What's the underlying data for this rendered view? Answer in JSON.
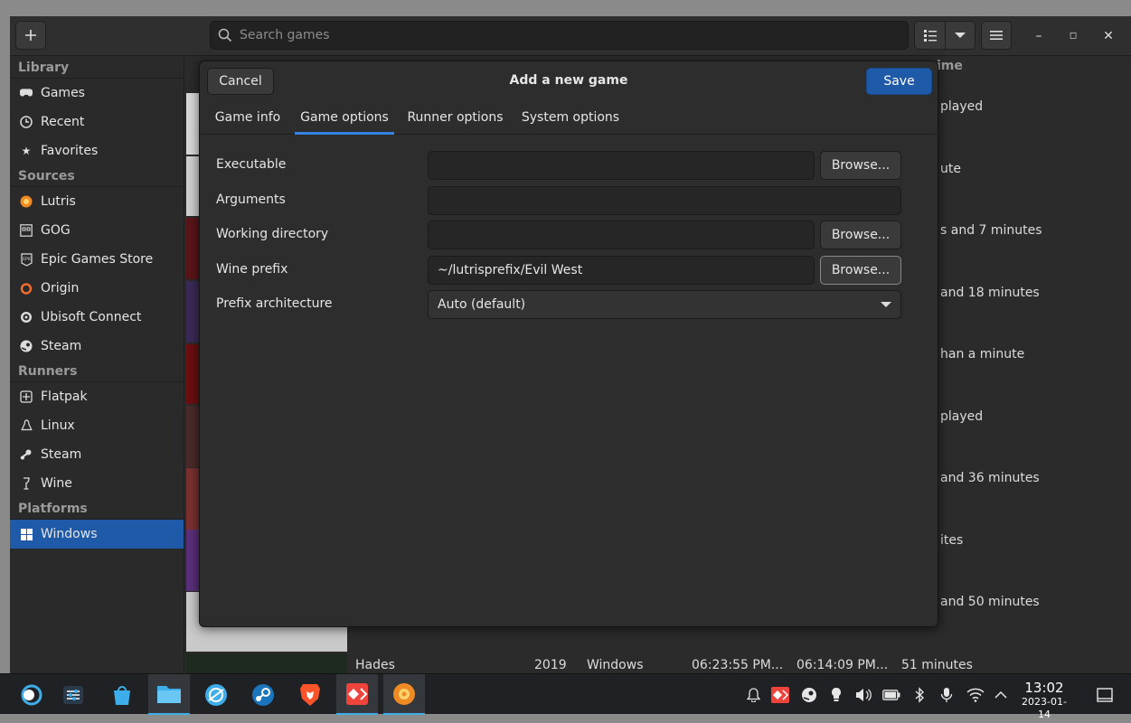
{
  "header": {
    "add_icon": "plus-icon",
    "search_placeholder": "Search games"
  },
  "sidebar": {
    "sections": [
      {
        "title": "Library",
        "items": [
          {
            "label": "Games",
            "icon": "gamepad-icon"
          },
          {
            "label": "Recent",
            "icon": "clock-icon"
          },
          {
            "label": "Favorites",
            "icon": "star-icon"
          }
        ]
      },
      {
        "title": "Sources",
        "items": [
          {
            "label": "Lutris",
            "icon": "lutris-icon"
          },
          {
            "label": "GOG",
            "icon": "gog-icon"
          },
          {
            "label": "Epic Games Store",
            "icon": "epic-icon"
          },
          {
            "label": "Origin",
            "icon": "origin-icon"
          },
          {
            "label": "Ubisoft Connect",
            "icon": "ubisoft-icon"
          },
          {
            "label": "Steam",
            "icon": "steam-icon"
          }
        ]
      },
      {
        "title": "Runners",
        "items": [
          {
            "label": "Flatpak",
            "icon": "flatpak-icon"
          },
          {
            "label": "Linux",
            "icon": "linux-icon"
          },
          {
            "label": "Steam",
            "icon": "steam-icon"
          },
          {
            "label": "Wine",
            "icon": "wine-icon"
          }
        ]
      },
      {
        "title": "Platforms",
        "items": [
          {
            "label": "Windows",
            "icon": "windows-icon",
            "active": true
          }
        ]
      }
    ]
  },
  "background_list": {
    "column_header": "ime",
    "playtimes": [
      "played",
      "ute",
      "s and 7 minutes",
      "and 18 minutes",
      "han a minute",
      "played",
      "and 36 minutes",
      "ites",
      "and 50 minutes"
    ],
    "last_row": {
      "name": "Hades",
      "year": "2019",
      "platform": "Windows",
      "last_played": "06:23:55 PM...",
      "installed_at": "06:14:09 PM...",
      "playtime": "51 minutes"
    }
  },
  "dialog": {
    "title": "Add a new game",
    "cancel_label": "Cancel",
    "save_label": "Save",
    "tabs": [
      "Game info",
      "Game options",
      "Runner options",
      "System options"
    ],
    "active_tab": "Game options",
    "fields": {
      "executable_label": "Executable",
      "executable_value": "",
      "arguments_label": "Arguments",
      "arguments_value": "",
      "working_dir_label": "Working directory",
      "working_dir_value": "",
      "wine_prefix_label": "Wine prefix",
      "wine_prefix_value": "~/lutrisprefix/Evil West",
      "prefix_arch_label": "Prefix architecture",
      "prefix_arch_value": "Auto (default)"
    },
    "browse_label": "Browse..."
  },
  "taskbar": {
    "apps": [
      "app-launcher-icon",
      "system-settings-icon",
      "discover-icon",
      "dolphin-file-manager-icon",
      "network-browser-icon",
      "steam-icon",
      "brave-icon",
      "anydesk-icon",
      "lutris-icon"
    ],
    "tray": [
      "notifications-icon",
      "anydesk-tray-icon",
      "steam-tray-icon",
      "lightbulb-icon",
      "volume-icon",
      "battery-icon",
      "bluetooth-icon",
      "microphone-icon",
      "wifi-icon",
      "chevron-up-icon"
    ],
    "clock_time": "13:02",
    "clock_date": "2023-01-14"
  }
}
